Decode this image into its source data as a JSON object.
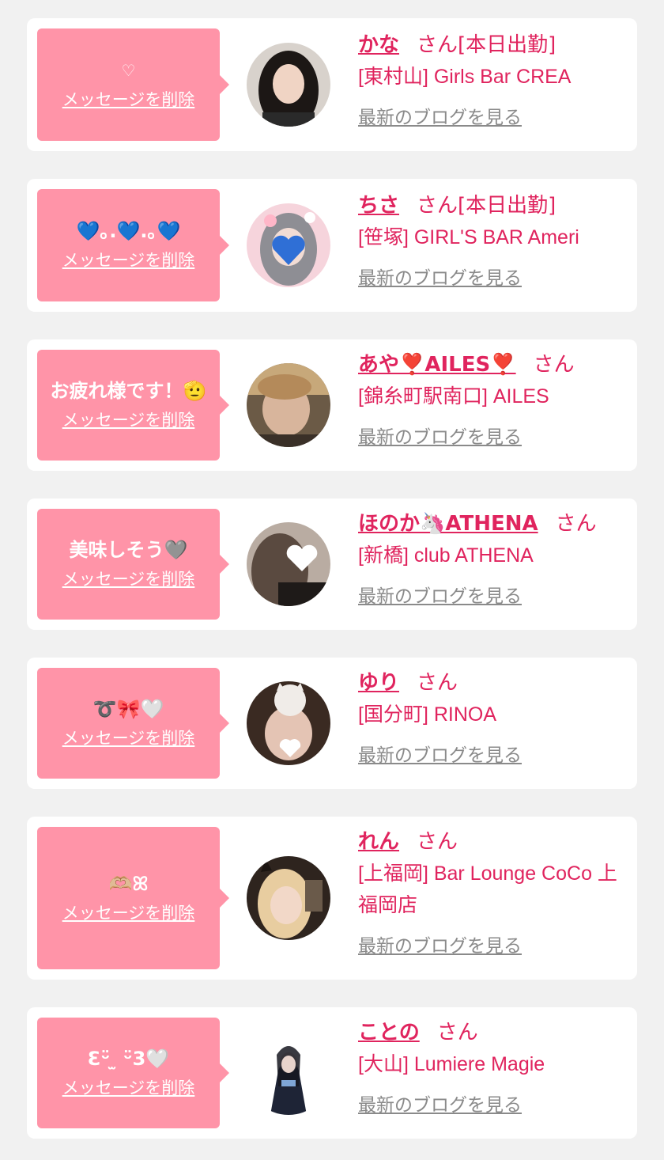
{
  "cards": [
    {
      "message": "♡",
      "message_light": true,
      "delete_label": "メッセージを削除",
      "name": "かな",
      "honorific": "さん",
      "status": "[本日出勤]",
      "shop": "[東村山] Girls Bar CREA",
      "blog_label": "最新のブログを見る",
      "avatar_colors": [
        "#d8d2cc",
        "#1c1715",
        "#f0d4c4"
      ]
    },
    {
      "message": "💙｡.💙.｡💙",
      "message_light": false,
      "delete_label": "メッセージを削除",
      "name": "ちさ",
      "honorific": "さん",
      "status": "[本日出勤]",
      "shop": "[笹塚] GIRL'S BAR Ameri",
      "blog_label": "最新のブログを見る",
      "avatar_colors": [
        "#f6d4dc",
        "#8e8e94",
        "#2f6fd6"
      ]
    },
    {
      "message": "お疲れ様です！🫡",
      "message_light": false,
      "delete_label": "メッセージを削除",
      "name": "あや❣️AILES❣️",
      "honorific": "さん",
      "status": "",
      "shop": "[錦糸町駅南口] AILES",
      "blog_label": "最新のブログを見る",
      "avatar_colors": [
        "#6b5a46",
        "#c7a87a",
        "#d8b59c"
      ]
    },
    {
      "message": "美味しそう🩶",
      "message_light": false,
      "delete_label": "メッセージを削除",
      "name": "ほのか🦄ATHENA",
      "honorific": "さん",
      "status": "",
      "shop": "[新橋] club ATHENA",
      "blog_label": "最新のブログを見る",
      "avatar_colors": [
        "#b9aca2",
        "#5a4a40",
        "#ffffff"
      ]
    },
    {
      "message": "➰🎀🤍",
      "message_light": false,
      "delete_label": "メッセージを削除",
      "name": "ゆり",
      "honorific": "さん",
      "status": "",
      "shop": "[国分町] RINOA",
      "blog_label": "最新のブログを見る",
      "avatar_colors": [
        "#3a2a22",
        "#f0ece8",
        "#e4c4b4"
      ]
    },
    {
      "message": "🫶🏼ꕤ",
      "message_light": false,
      "delete_label": "メッセージを削除",
      "name": "れん",
      "honorific": "さん",
      "status": "",
      "shop": "[上福岡] Bar Lounge CoCo 上福岡店",
      "blog_label": "最新のブログを見る",
      "avatar_colors": [
        "#2e241e",
        "#e8cda0",
        "#f2d8c8"
      ]
    },
    {
      "message": "Ɛᵕ̈ ̫ ᵕ̈3🤍",
      "message_light": false,
      "delete_label": "メッセージを削除",
      "name": "ことの",
      "honorific": "さん",
      "status": "",
      "shop": "[大山] Lumiere Magie",
      "blog_label": "最新のブログを見る",
      "avatar_colors": [
        "#ffffff",
        "#1e2436",
        "#e8d4cc"
      ]
    }
  ],
  "colors": {
    "page_bg": "#f1f1f1",
    "card_bg": "#ffffff",
    "bubble_bg": "#ff94a8",
    "accent": "#e0245e",
    "muted_link": "#8a8a8a"
  }
}
